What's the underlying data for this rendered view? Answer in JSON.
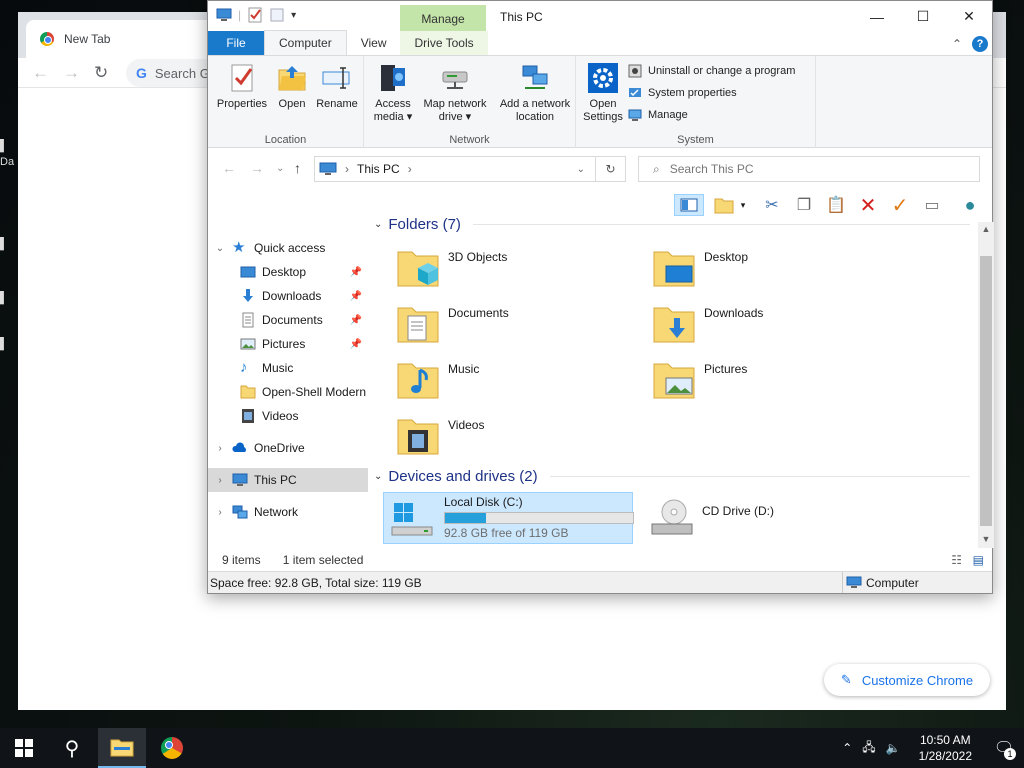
{
  "desktop": {
    "fragments": [
      "Da"
    ]
  },
  "chrome": {
    "tab_title": "New Tab",
    "omnibox_placeholder": "Search G",
    "customize_label": "Customize Chrome"
  },
  "explorer": {
    "window_title": "This PC",
    "manage_tab": "Manage",
    "ribbon_tabs": [
      "File",
      "Computer",
      "View",
      "Drive Tools"
    ],
    "groups": {
      "location": {
        "label": "Location",
        "buttons": [
          "Properties",
          "Open",
          "Rename"
        ]
      },
      "network": {
        "label": "Network",
        "access_media": [
          "Access",
          "media ▾"
        ],
        "map_network": [
          "Map network",
          "drive ▾"
        ],
        "add_network": [
          "Add a network",
          "location"
        ]
      },
      "system": {
        "label": "System",
        "open_settings": [
          "Open",
          "Settings"
        ],
        "uninstall": "Uninstall or change a program",
        "system_properties": "System properties",
        "manage": "Manage"
      }
    },
    "address": {
      "path": "This PC",
      "search_placeholder": "Search This PC"
    },
    "nav": {
      "quick_access": "Quick access",
      "items": [
        {
          "label": "Desktop",
          "pinned": true
        },
        {
          "label": "Downloads",
          "pinned": true
        },
        {
          "label": "Documents",
          "pinned": true
        },
        {
          "label": "Pictures",
          "pinned": true
        },
        {
          "label": "Music",
          "pinned": false
        },
        {
          "label": "Open-Shell Modern",
          "pinned": false
        },
        {
          "label": "Videos",
          "pinned": false
        }
      ],
      "onedrive": "OneDrive",
      "this_pc": "This PC",
      "network": "Network"
    },
    "folders_header": "Folders (7)",
    "folders": [
      "3D Objects",
      "Desktop",
      "Documents",
      "Downloads",
      "Music",
      "Pictures",
      "Videos"
    ],
    "devices_header": "Devices and drives (2)",
    "drives": [
      {
        "name": "Local Disk (C:)",
        "free_text": "92.8 GB free of 119 GB",
        "used_fraction": 0.22
      },
      {
        "name": "CD Drive (D:)"
      }
    ],
    "status": {
      "items": "9 items",
      "selected": "1 item selected"
    },
    "bottom_status": {
      "space": "Space free: 92.8 GB, Total size: 119 GB",
      "computer": "Computer"
    }
  },
  "taskbar": {
    "time": "10:50 AM",
    "date": "1/28/2022",
    "notification_count": "1"
  },
  "colors": {
    "accent": "#1979ca",
    "manage_tab": "#c4e5a9",
    "selection": "#cce8ff",
    "drive_bar": "#26a0da",
    "section_header": "#1e3287"
  }
}
